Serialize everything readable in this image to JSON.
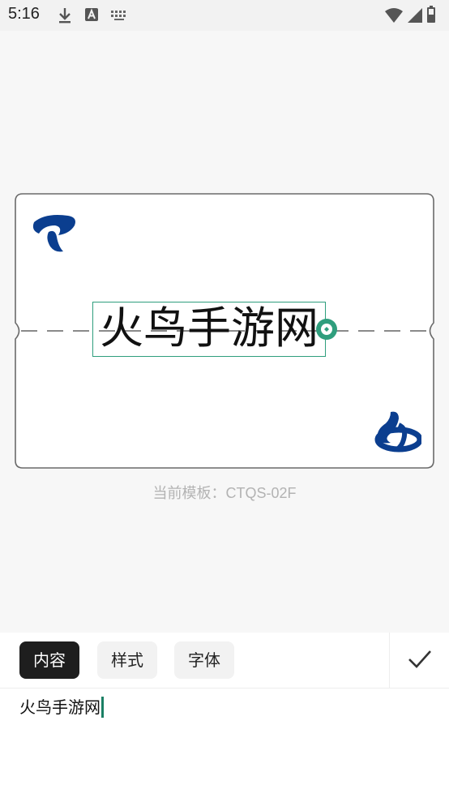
{
  "status_bar": {
    "time": "5:16",
    "left_icons": [
      "download-icon",
      "font-a-icon",
      "keyboard-icon"
    ],
    "right_icons": [
      "wifi-icon",
      "signal-icon",
      "battery-icon"
    ]
  },
  "canvas": {
    "label_text": "火鸟手游网",
    "template_caption": "当前模板：CTQS-02F",
    "logos": [
      "china-telecom-logo"
    ],
    "accent_color": "#2f9e7d",
    "logo_color": "#0b3e8f"
  },
  "editor": {
    "tabs": [
      {
        "label": "内容",
        "active": true
      },
      {
        "label": "样式",
        "active": false
      },
      {
        "label": "字体",
        "active": false
      }
    ],
    "confirm_icon": "check-icon",
    "content_value": "火鸟手游网"
  }
}
